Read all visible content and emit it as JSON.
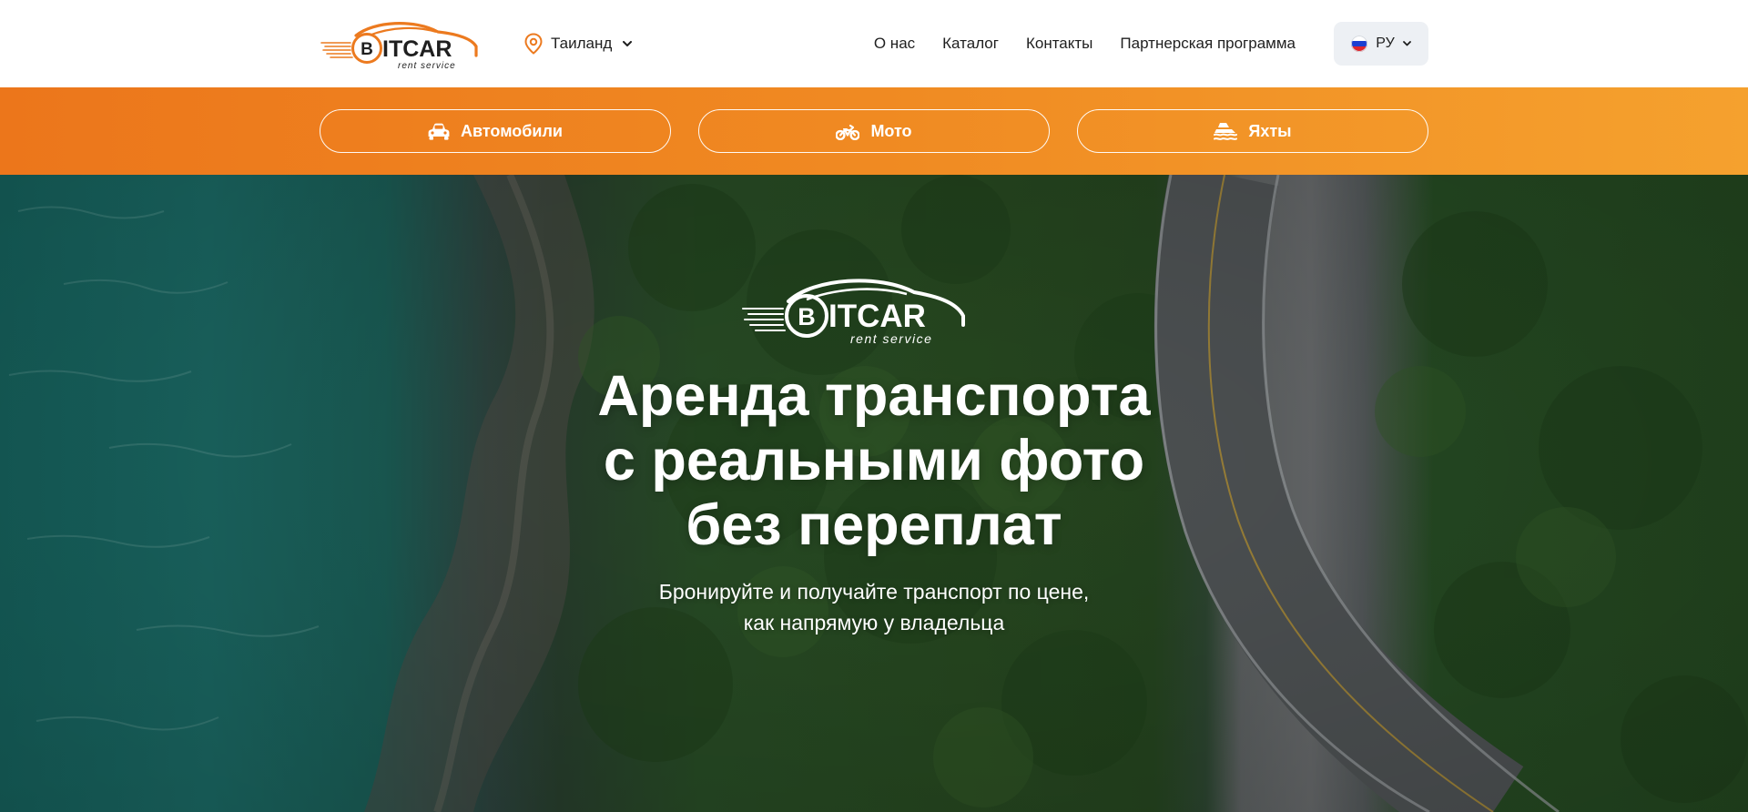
{
  "header": {
    "logo": {
      "text": "ITCAR",
      "letter": "B",
      "tagline": "rent service"
    },
    "location": {
      "label": "Таиланд",
      "icon": "map-pin-icon"
    },
    "nav": [
      {
        "label": "О нас"
      },
      {
        "label": "Каталог"
      },
      {
        "label": "Контакты"
      },
      {
        "label": "Партнерская программа"
      }
    ],
    "language": {
      "label": "РУ",
      "flag": "russia-flag-icon"
    }
  },
  "categories": [
    {
      "label": "Автомобили",
      "icon": "car-icon"
    },
    {
      "label": "Мото",
      "icon": "motorbike-icon"
    },
    {
      "label": "Яхты",
      "icon": "yacht-icon"
    }
  ],
  "hero": {
    "title_lines": [
      "Аренда транспорта",
      "с реальными фото",
      "без переплат"
    ],
    "subtitle_lines": [
      "Бронируйте и получайте транспорт по цене,",
      "как напрямую у владельца"
    ]
  },
  "colors": {
    "accent": "#f08a22",
    "accent_dark": "#ec761b",
    "text": "#1f1f1f",
    "lang_bg": "#edf0f4"
  }
}
